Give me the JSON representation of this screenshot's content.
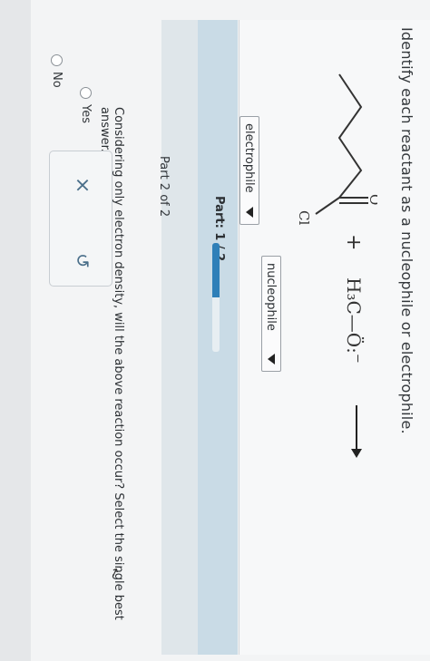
{
  "question": {
    "text": "Identify each reactant as a nucleophile or electrophile.",
    "reactant_1": {
      "carbonyl_label": "O",
      "halogen_label": "Cl",
      "dropdown_value": "electrophile"
    },
    "plus": "+",
    "reactant_2": {
      "formula": "H₃C—Ö:",
      "charge": "−",
      "dropdown_value": "nucleophile"
    }
  },
  "progress": {
    "label": "Part: 1 / 2",
    "fraction": 0.5
  },
  "part2": {
    "label": "Part 2 of 2",
    "question": "Considering only electron density, will the above reaction occur? Select the single best answer.",
    "options": [
      "Yes",
      "No"
    ]
  },
  "actions": {
    "clear_icon": "x-icon",
    "undo_icon": "undo-icon",
    "clear_glyph": "×",
    "undo_glyph": "↺"
  },
  "colors": {
    "accent": "#2e7fb8",
    "part_bar": "#c9dbe6"
  }
}
